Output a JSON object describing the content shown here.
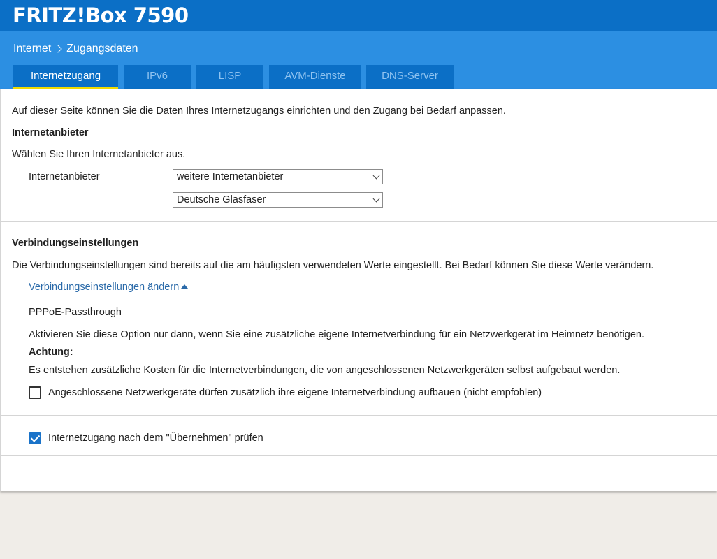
{
  "app": {
    "title": "FRITZ!Box 7590"
  },
  "breadcrumb": {
    "section": "Internet",
    "page": "Zugangsdaten"
  },
  "tabs": [
    {
      "label": "Internetzugang",
      "active": true
    },
    {
      "label": "IPv6",
      "active": false
    },
    {
      "label": "LISP",
      "active": false
    },
    {
      "label": "AVM-Dienste",
      "active": false
    },
    {
      "label": "DNS-Server",
      "active": false
    }
  ],
  "intro": "Auf dieser Seite können Sie die Daten Ihres Internetzugangs einrichten und den Zugang bei Bedarf anpassen.",
  "provider": {
    "heading": "Internetanbieter",
    "instruction": "Wählen Sie Ihren Internetanbieter aus.",
    "label": "Internetanbieter",
    "select1_value": "weitere Internetanbieter",
    "select2_value": "Deutsche Glasfaser"
  },
  "connection": {
    "heading": "Verbindungseinstellungen",
    "description": "Die Verbindungseinstellungen sind bereits auf die am häufigsten verwendeten Werte eingestellt. Bei Bedarf können Sie diese Werte verändern.",
    "toggle_link": "Verbindungseinstellungen ändern",
    "pppoe_title": "PPPoE-Passthrough",
    "pppoe_desc": "Aktivieren Sie diese Option nur dann, wenn Sie eine zusätzliche eigene Internetverbindung für ein Netzwerkgerät im Heimnetz benötigen.",
    "warning_label": "Achtung:",
    "warning_text": "Es entstehen zusätzliche Kosten für die Internetverbindungen, die von angeschlossenen Netzwerkgeräten selbst aufgebaut werden.",
    "passthrough_checkbox_label": "Angeschlossene Netzwerkgeräte dürfen zusätzlich ihre eigene Internetverbindung aufbauen (nicht empfohlen)",
    "passthrough_checked": false
  },
  "check": {
    "label": "Internetzugang nach dem \"Übernehmen\" prüfen",
    "checked": true
  },
  "colors": {
    "header": "#0b6fc6",
    "subbar": "#2c8fe2",
    "tab_underline": "#f2dd00",
    "link": "#2a6aa9",
    "checkbox": "#1a73c9"
  }
}
